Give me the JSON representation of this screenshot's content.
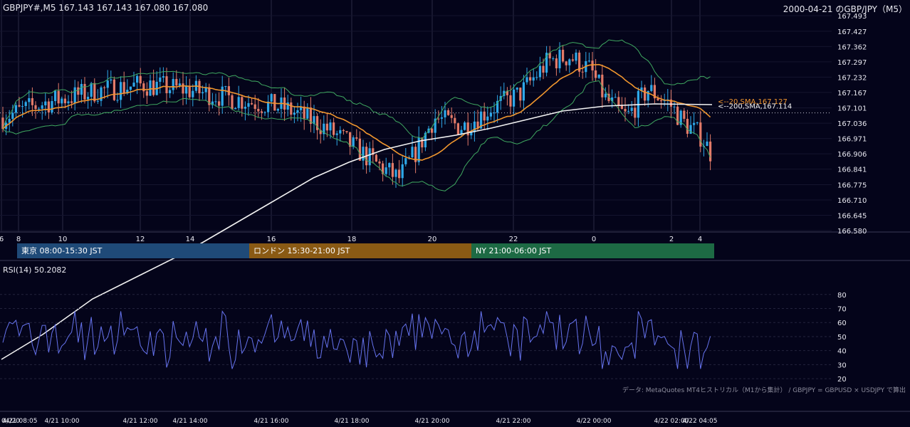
{
  "header": {
    "symbol_info": "GBPJPY#,M5 167.143 167.143 167.080 167.080",
    "title": "2000-04-21 のGBP/JPY（M5）"
  },
  "sessions": [
    {
      "label": "東京 08:00-15:30 JST",
      "color": "#1f4a78"
    },
    {
      "label": "ロンドン 15:30-21:00 JST",
      "color": "#8a5a14"
    },
    {
      "label": "NY 21:00-06:00 JST",
      "color": "#1d6a44"
    }
  ],
  "rsi": {
    "label": "RSI(14) 50.2082"
  },
  "footer_note": "データ: MetaQuotes MT4ヒストリカル（M1から集計） / GBPJPY = GBPUSD × USDJPY で算出",
  "colors": {
    "background": "#04041a",
    "up": "#2ea8e8",
    "down": "#e27a68",
    "sma20": "#f0962e",
    "sma200": "#f2f2f2",
    "bollinger": "#3fa860",
    "rsi": "#6673ee"
  },
  "chart_data": [
    {
      "type": "candlestick",
      "pane": "price",
      "ylim": [
        166.58,
        167.493
      ],
      "y_ticks": [
        "167.493",
        "167.427",
        "167.362",
        "167.297",
        "167.232",
        "167.167",
        "167.101",
        "167.036",
        "166.971",
        "166.906",
        "166.841",
        "166.775",
        "166.710",
        "166.645",
        "166.580"
      ],
      "x_ticks": [
        "6",
        "8",
        "10",
        "12",
        "14",
        "16",
        "18",
        "20",
        "22",
        "0",
        "2",
        "4"
      ],
      "last_close": 167.08,
      "series": [
        {
          "name": "20,SMA,167.127",
          "label": "<--20,SMA,167.127",
          "value": 167.127
        },
        {
          "name": "200,SMA,167.114",
          "label": "<--200,SMA,167.114",
          "value": 167.114
        },
        {
          "name": "Bollinger Bands"
        }
      ],
      "grid": true
    },
    {
      "type": "line",
      "pane": "rsi",
      "name": "RSI(14)",
      "value": 50.2082,
      "ylim": [
        15,
        88
      ],
      "y_ticks": [
        "80",
        "70",
        "60",
        "50",
        "40",
        "30",
        "20"
      ],
      "x_ticks": [
        "4/21 08:05",
        "4/21 10:00",
        "4/21 12:00",
        "4/21 14:00",
        "4/21 16:00",
        "4/21 18:00",
        "4/21 20:00",
        "4/21 22:00",
        "4/22 00:00",
        "4/22 02:00",
        "4/22 04:05"
      ],
      "extra_left_label": "04/20",
      "grid": true
    }
  ]
}
